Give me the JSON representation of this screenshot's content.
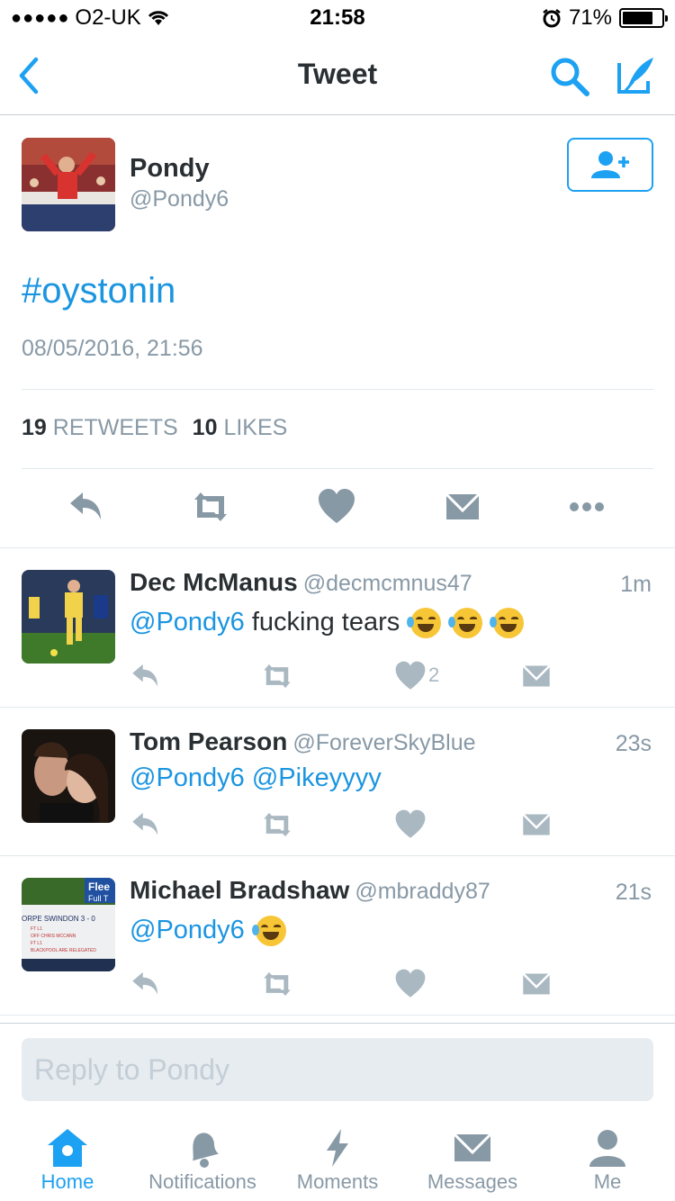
{
  "status_bar": {
    "carrier": "O2-UK",
    "time": "21:58",
    "battery": "71%"
  },
  "nav": {
    "title": "Tweet"
  },
  "tweet": {
    "author_name": "Pondy",
    "author_handle": "@Pondy6",
    "text": "#oystonin",
    "date": "08/05/2016, 21:56",
    "retweet_count": "19",
    "retweet_label": "RETWEETS",
    "like_count": "10",
    "like_label": "LIKES"
  },
  "replies": [
    {
      "name": "Dec McManus",
      "handle": "@decmcmnus47",
      "time": "1m",
      "mention": "@Pondy6",
      "text": "fucking tears",
      "likes": "2"
    },
    {
      "name": "Tom Pearson",
      "handle": "@ForeverSkyBlue",
      "time": "23s",
      "mention": "@Pondy6 @Pikeyyyy",
      "text": "",
      "likes": ""
    },
    {
      "name": "Michael Bradshaw",
      "handle": "@mbraddy87",
      "time": "21s",
      "mention": "@Pondy6",
      "text": "",
      "likes": "",
      "avatar_text": {
        "brand": "Flee",
        "sub": "Full T",
        "score": "ORPE   SWINDON 3 - 0",
        "lines": [
          "FT    L1",
          "OFF   CHRIS MCCANN",
          "FT    L1",
          "BLACKPOOL ARE RELEGATED"
        ]
      }
    }
  ],
  "reply_bar": {
    "placeholder": "Reply to Pondy"
  },
  "tabs": [
    {
      "label": "Home"
    },
    {
      "label": "Notifications"
    },
    {
      "label": "Moments"
    },
    {
      "label": "Messages"
    },
    {
      "label": "Me"
    }
  ],
  "colors": {
    "accent": "#1da1f2",
    "link": "#1b95e0",
    "muted": "#8899a6",
    "icon": "#8899a6",
    "icon_light": "#aab8c2"
  }
}
